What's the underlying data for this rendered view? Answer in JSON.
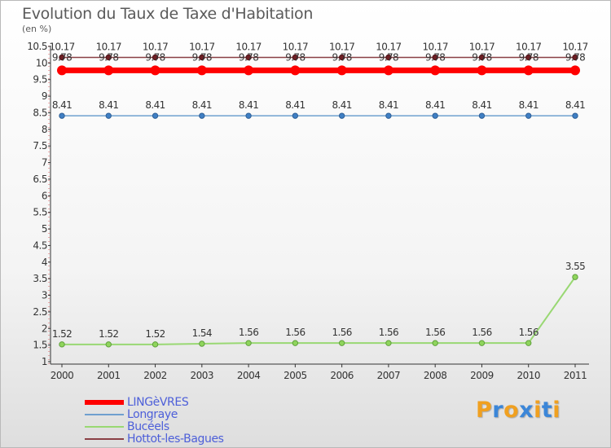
{
  "title": "Evolution du Taux de Taxe d'Habitation",
  "subtitle": "(en %)",
  "logo": {
    "letters": [
      "P",
      "r",
      "o",
      "x",
      "i",
      "t",
      "i"
    ],
    "colors": [
      "#f0a020",
      "#3b86d8",
      "#f0a020",
      "#3b86d8",
      "#f0a020",
      "#3b86d8",
      "#f0a020"
    ]
  },
  "chart_data": {
    "type": "line",
    "title": "Evolution du Taux de Taxe d'Habitation",
    "ylabel": "(en %)",
    "xlabel": "",
    "categories": [
      "2000",
      "2001",
      "2002",
      "2003",
      "2004",
      "2005",
      "2006",
      "2007",
      "2008",
      "2009",
      "2010",
      "2011"
    ],
    "ylim": [
      1,
      10.5
    ],
    "yticks": [
      "1",
      "1.5",
      "2",
      "2.5",
      "3",
      "3.5",
      "4",
      "4.5",
      "5",
      "5.5",
      "6",
      "6.5",
      "7",
      "7.5",
      "8",
      "8.5",
      "9",
      "9.5",
      "10",
      "10.5"
    ],
    "grid": false,
    "legend_position": "bottom-left",
    "series": [
      {
        "name": "LINGèVRES",
        "color": "#ff0000",
        "values": [
          9.78,
          9.78,
          9.78,
          9.78,
          9.78,
          9.78,
          9.78,
          9.78,
          9.78,
          9.78,
          9.78,
          9.78
        ],
        "labels": [
          "9.78",
          "9.78",
          "9.78",
          "9.78",
          "9.78",
          "9.78",
          "9.78",
          "9.78",
          "9.78",
          "9.78",
          "9.78",
          "9.78"
        ]
      },
      {
        "name": "Longraye",
        "color": "#6fa0cf",
        "values": [
          8.41,
          8.41,
          8.41,
          8.41,
          8.41,
          8.41,
          8.41,
          8.41,
          8.41,
          8.41,
          8.41,
          8.41
        ],
        "labels": [
          "8.41",
          "8.41",
          "8.41",
          "8.41",
          "8.41",
          "8.41",
          "8.41",
          "8.41",
          "8.41",
          "8.41",
          "8.41",
          "8.41"
        ]
      },
      {
        "name": "Bucéels",
        "color": "#99d873",
        "values": [
          1.52,
          1.52,
          1.52,
          1.54,
          1.56,
          1.56,
          1.56,
          1.56,
          1.56,
          1.56,
          1.56,
          3.55
        ],
        "labels": [
          "1.52",
          "1.52",
          "1.52",
          "1.54",
          "1.56",
          "1.56",
          "1.56",
          "1.56",
          "1.56",
          "1.56",
          "1.56",
          "3.55"
        ]
      },
      {
        "name": "Hottot-les-Bagues",
        "color": "#8a4045",
        "values": [
          10.17,
          10.17,
          10.17,
          10.17,
          10.17,
          10.17,
          10.17,
          10.17,
          10.17,
          10.17,
          10.17,
          10.17
        ],
        "labels": [
          "10.17",
          "10.17",
          "10.17",
          "10.17",
          "10.17",
          "10.17",
          "10.17",
          "10.17",
          "10.17",
          "10.17",
          "10.17",
          "10.17"
        ]
      }
    ]
  }
}
